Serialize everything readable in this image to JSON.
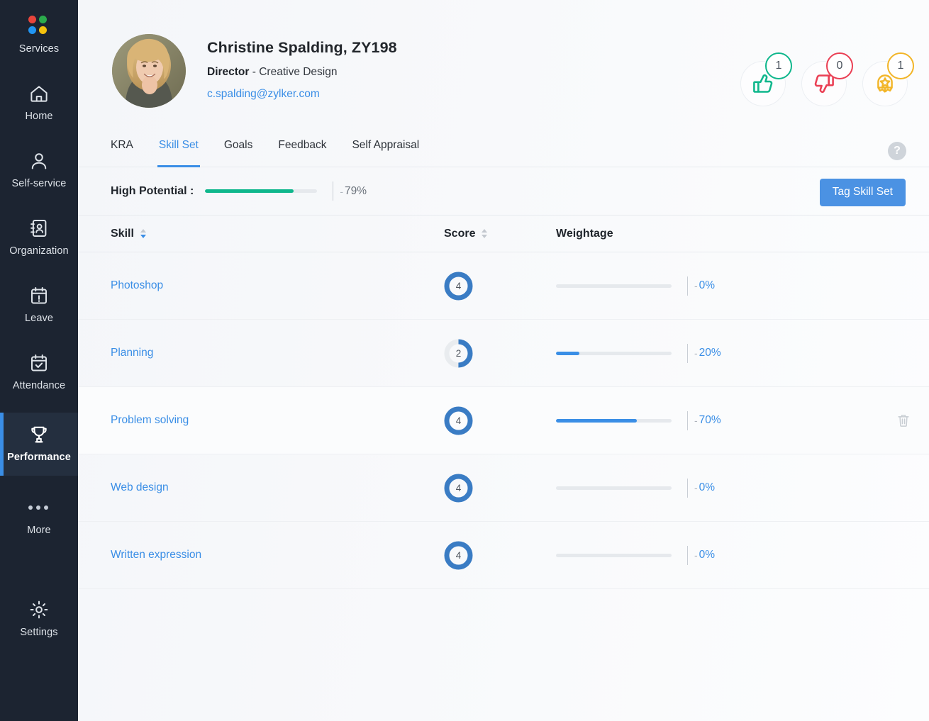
{
  "sidebar": {
    "items": [
      {
        "label": "Services",
        "icon": "services-dots-icon",
        "active": false
      },
      {
        "label": "Home",
        "icon": "home-icon",
        "active": false
      },
      {
        "label": "Self-service",
        "icon": "user-icon",
        "active": false
      },
      {
        "label": "Organization",
        "icon": "address-book-icon",
        "active": false
      },
      {
        "label": "Leave",
        "icon": "calendar-alert-icon",
        "active": false
      },
      {
        "label": "Attendance",
        "icon": "calendar-check-icon",
        "active": false
      },
      {
        "label": "Performance",
        "icon": "trophy-icon",
        "active": true
      },
      {
        "label": "More",
        "icon": "ellipsis-icon",
        "active": false
      },
      {
        "label": "Settings",
        "icon": "gear-icon",
        "active": false
      }
    ],
    "logo_dot_colors": [
      "#e8453c",
      "#2bab4c",
      "#2196f3",
      "#f4c20d"
    ]
  },
  "profile": {
    "name": "Christine Spalding, ZY198",
    "designation": "Director",
    "department_separator": " - ",
    "department": "Creative Design",
    "email": "c.spalding@zylker.com",
    "avatar_alt": "profile-photo"
  },
  "badges": [
    {
      "name": "thumbs-up-badge",
      "icon": "thumbs-up-icon",
      "count": "1",
      "color": "#0fb78c",
      "variant": "green"
    },
    {
      "name": "thumbs-down-badge",
      "icon": "thumbs-down-icon",
      "count": "0",
      "color": "#ea3f54",
      "variant": "red"
    },
    {
      "name": "award-badge",
      "icon": "award-medal-icon",
      "count": "1",
      "color": "#f2b528",
      "variant": "yellow"
    }
  ],
  "tabs": [
    {
      "label": "KRA",
      "active": false
    },
    {
      "label": "Skill Set",
      "active": true
    },
    {
      "label": "Goals",
      "active": false
    },
    {
      "label": "Feedback",
      "active": false
    },
    {
      "label": "Self Appraisal",
      "active": false
    }
  ],
  "help": {
    "glyph": "?"
  },
  "potential": {
    "label": "High Potential :",
    "percent": 79,
    "value_text": "79%",
    "dash": "-",
    "color": "#0fb78c"
  },
  "actions": {
    "tag_skill_set": "Tag Skill Set"
  },
  "table": {
    "columns": [
      {
        "key": "skill",
        "label": "Skill",
        "sortable": true,
        "sort_active": true
      },
      {
        "key": "score",
        "label": "Score",
        "sortable": true,
        "sort_active": false
      },
      {
        "key": "weightage",
        "label": "Weightage",
        "sortable": false,
        "sort_active": false
      }
    ],
    "score_max": 4,
    "rows": [
      {
        "skill": "Photoshop",
        "score": "4",
        "score_fraction": 1.0,
        "weightage": 0,
        "weightage_text": "0%",
        "hovered": false,
        "dash": "-"
      },
      {
        "skill": "Planning",
        "score": "2",
        "score_fraction": 0.5,
        "weightage": 20,
        "weightage_text": "20%",
        "hovered": false,
        "dash": "-"
      },
      {
        "skill": "Problem solving",
        "score": "4",
        "score_fraction": 1.0,
        "weightage": 70,
        "weightage_text": "70%",
        "hovered": true,
        "dash": "-",
        "delete_icon": "trash-icon"
      },
      {
        "skill": "Web design",
        "score": "4",
        "score_fraction": 1.0,
        "weightage": 0,
        "weightage_text": "0%",
        "hovered": false,
        "dash": "-"
      },
      {
        "skill": "Written expression",
        "score": "4",
        "score_fraction": 1.0,
        "weightage": 0,
        "weightage_text": "0%",
        "hovered": false,
        "dash": "-"
      }
    ]
  },
  "colors": {
    "accent_blue": "#3a8ee6",
    "button_blue": "#4b92e3",
    "green": "#0fb78c",
    "red": "#ea3f54",
    "yellow": "#f2b528",
    "sidebar_bg": "#1c2431",
    "sidebar_active_bg": "#242f3f"
  }
}
